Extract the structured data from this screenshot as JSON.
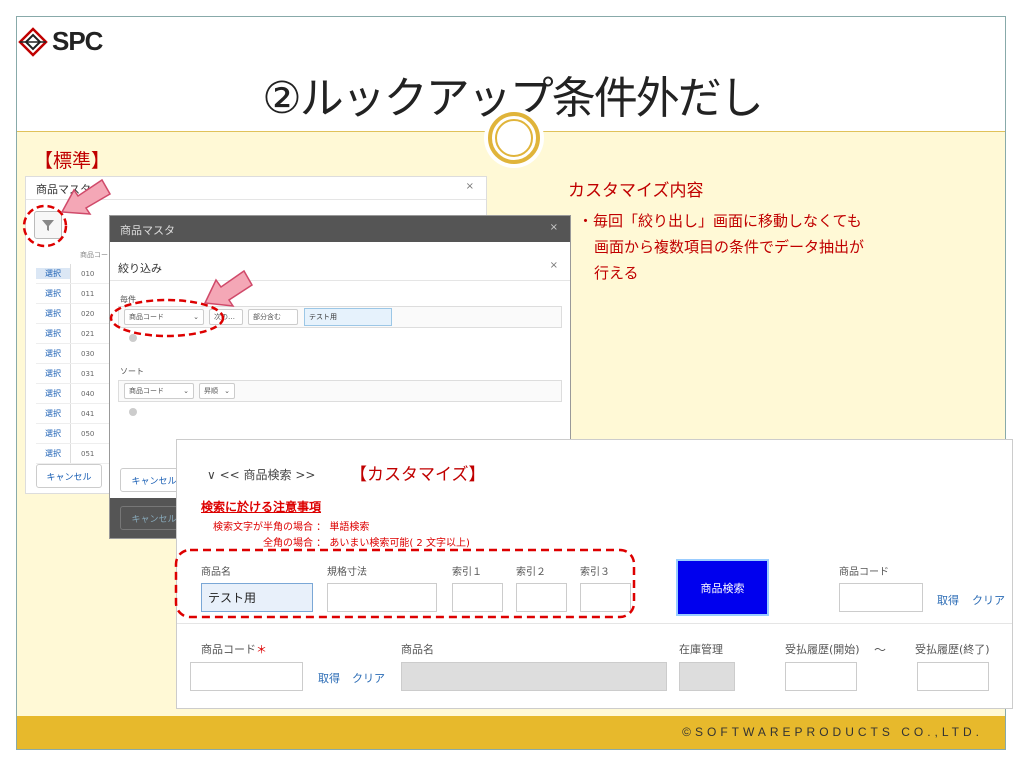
{
  "slide": {
    "title": "②ルックアップ条件外だし",
    "logo_text": "SPC",
    "footer": "©SOFTWAREPRODUCTS CO.,LTD.",
    "standard_label": "【標準】",
    "customize_heading": "カスタマイズ内容",
    "customize_lines": [
      "・毎回「絞り出し」画面に移動しなくても",
      "画面から複数項目の条件でデータ抽出が",
      "行える"
    ]
  },
  "screenshot1": {
    "title": "商品マスタ",
    "close": "×",
    "column_header": "商品コー",
    "select_label": "選択",
    "codes": [
      "010",
      "011",
      "020",
      "021",
      "030",
      "031",
      "040",
      "041",
      "050",
      "051"
    ],
    "cancel": "キャンセル"
  },
  "screenshot2": {
    "bg_title": "商品マスタ",
    "close": "×",
    "dialog_title": "絞り込み",
    "filter_label": "毎件",
    "filter_field": "商品コード",
    "filter_op": "次の…",
    "filter_mode": "部分含む",
    "filter_value": "テスト用",
    "sort_label": "ソート",
    "sort_field": "商品コード",
    "sort_order": "昇順",
    "cancel": "キャンセル",
    "bottom_button": "キャンセル"
  },
  "screenshot3": {
    "section_header": "∨ << 商品検索 >>",
    "tag": "【カスタマイズ】",
    "warning_title": "検索に於ける注意事項",
    "note1": "検索文字が半角の場合 ： 単語検索",
    "note2": "全角の場合 ： あいまい検索可能( 2 文字以上)",
    "fields": {
      "name_label": "商品名",
      "name_value": "テスト用",
      "spec_label": "規格寸法",
      "idx1_label": "索引１",
      "idx2_label": "索引２",
      "idx3_label": "索引３",
      "search_button": "商品検索",
      "code_label": "商品コード",
      "get_link": "取得",
      "clear_link": "クリア"
    },
    "lower": {
      "code_label": "商品コード",
      "required": "＊",
      "name_label": "商品名",
      "stock_label": "在庫管理",
      "hist_start_label": "受払履歴(開始)",
      "tilde": "～",
      "hist_end_label": "受払履歴(終了)",
      "get_link": "取得",
      "clear_link": "クリア"
    }
  },
  "colors": {
    "accent_red": "#c00000",
    "footer_gold": "#e7b92c",
    "search_blue": "#0000ee"
  }
}
